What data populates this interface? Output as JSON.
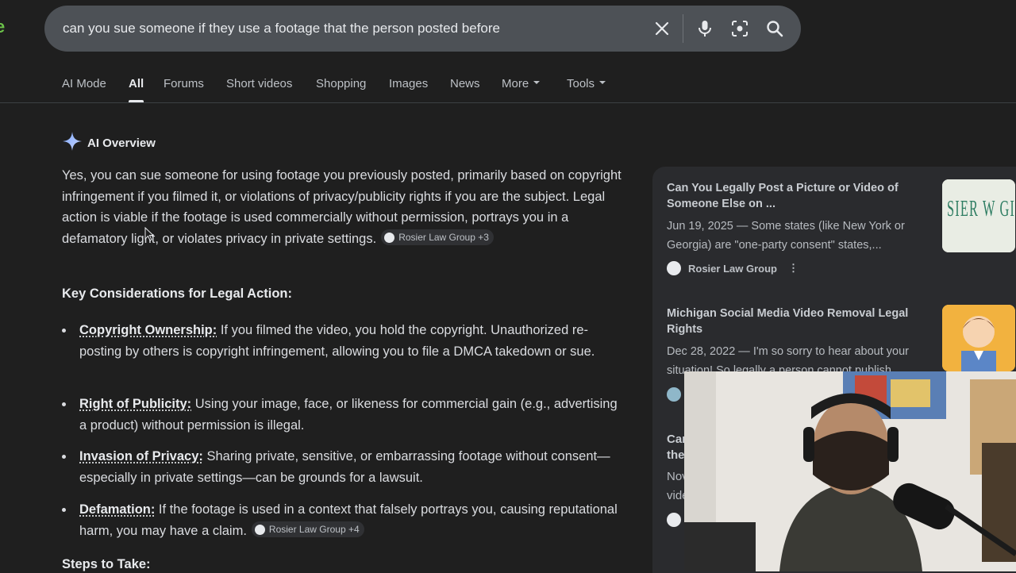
{
  "search": {
    "query": "can you sue someone if they use a footage that the person posted before",
    "icons": [
      "close-icon",
      "mic-icon",
      "lens-icon",
      "search-icon"
    ]
  },
  "tabs": [
    {
      "label": "AI Mode",
      "active": false
    },
    {
      "label": "All",
      "active": true
    },
    {
      "label": "Forums",
      "active": false
    },
    {
      "label": "Short videos",
      "active": false
    },
    {
      "label": "Shopping",
      "active": false
    },
    {
      "label": "Images",
      "active": false
    },
    {
      "label": "News",
      "active": false
    },
    {
      "label": "More",
      "active": false,
      "dropdown": true
    },
    {
      "label": "Tools",
      "active": false,
      "dropdown": true
    }
  ],
  "overview": {
    "title": "AI Overview",
    "intro": "Yes, you can sue someone for using footage you previously posted, primarily based on copyright infringement if you filmed it, or violations of privacy/publicity rights if you are the subject. Legal action is viable if the footage is used commercially without permission, portrays you in a defamatory light, or violates privacy in private settings.",
    "intro_chip": "Rosier Law Group +3",
    "section_title": "Key Considerations for Legal Action:",
    "bullets": [
      {
        "term": "Copyright Ownership:",
        "text": " If you filmed the video, you hold the copyright. Unauthorized re-posting by others is copyright infringement, allowing you to file a DMCA takedown or sue."
      },
      {
        "term": "Right of Publicity:",
        "text": " Using your image, face, or likeness for commercial gain (e.g., advertising a product) without permission is illegal."
      },
      {
        "term": "Invasion of Privacy:",
        "text": " Sharing private, sensitive, or embarrassing footage without consent—especially in private settings—can be grounds for a lawsuit."
      },
      {
        "term": "Defamation:",
        "text": " If the footage is used in a context that falsely portrays you, causing reputational harm, you may have a claim."
      }
    ],
    "last_chip": "Rosier Law Group +4",
    "steps_title": "Steps to Take:"
  },
  "sources": [
    {
      "title": "Can You Legally Post a Picture or Video of Someone Else on ...",
      "snippet": "Jun 19, 2025 — Some states (like New York or Georgia) are \"one-party consent\" states,...",
      "source": "Rosier Law Group"
    },
    {
      "title": "Michigan Social Media Video Removal Legal Rights",
      "snippet": "Dec 28, 2022 — I'm so sorry to hear about your situation! So legally a person cannot publish"
    },
    {
      "peek_lines": [
        "Car",
        "the",
        "Nov",
        "vide"
      ]
    }
  ],
  "thumb1_text": "SIER W GI"
}
